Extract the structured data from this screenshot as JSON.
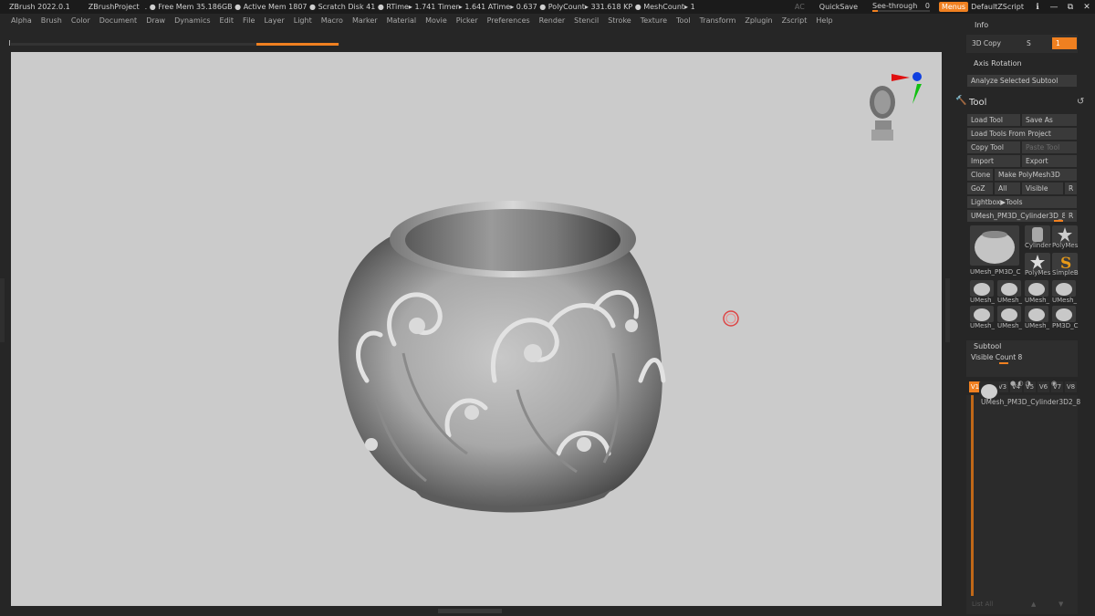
{
  "titlebar": {
    "app": "ZBrush 2022.0.1",
    "project": "ZBrushProject",
    "stats": ". ● Free Mem 35.186GB ● Active Mem 1807 ● Scratch Disk 41 ●  RTime▸ 1.741 Timer▸ 1.641 ATime▸ 0.637 ● PolyCount▸ 331.618 KP  ● MeshCount▸ 1",
    "ac": "AC",
    "quicksave": "QuickSave",
    "seethrough": "See-through",
    "seethrough_value": "0",
    "menus": "Menus",
    "script": "DefaultZScript",
    "win_icons": [
      "ℹ",
      "—",
      "⧉",
      "✕"
    ]
  },
  "menubar": {
    "items": [
      "Alpha",
      "Brush",
      "Color",
      "Document",
      "Draw",
      "Dynamics",
      "Edit",
      "File",
      "Layer",
      "Light",
      "Macro",
      "Marker",
      "Material",
      "Movie",
      "Picker",
      "Preferences",
      "Render",
      "Stencil",
      "Stroke",
      "Texture",
      "Tool",
      "Transform",
      "Zplugin",
      "Zscript",
      "Help"
    ]
  },
  "right": {
    "info": "Info",
    "copy3d": "3D Copy",
    "copy3d_s": "S",
    "copy3d_val": "1",
    "axis_rotation": "Axis Rotation",
    "analyze": "Analyze Selected Subtool",
    "tool": "Tool",
    "load_tool": "Load Tool",
    "save_as": "Save As",
    "load_from_project": "Load Tools From Project",
    "copy_tool": "Copy Tool",
    "paste_tool": "Paste Tool",
    "import": "Import",
    "export": "Export",
    "clone": "Clone",
    "make_polymesh": "Make PolyMesh3D",
    "goz": "GoZ",
    "all": "All",
    "visible": "Visible",
    "r": "R",
    "lightbox_tools": "Lightbox▶Tools",
    "current_tool": "UMesh_PM3D_Cylinder3D_8",
    "current_tool_r": "R",
    "thumb_labels": [
      "UMesh_PM3D_C",
      "Cylinder",
      "PolyMes",
      "PolyMes",
      "SimpleB",
      "UMesh_",
      "UMesh_",
      "UMesh_",
      "UMesh_",
      "UMesh_",
      "UMesh_",
      "UMesh_",
      "PM3D_C"
    ],
    "subtool": "Subtool",
    "visible_count": "Visible Count 8",
    "vtabs": [
      "V1",
      "V2",
      "V3",
      "V4",
      "V5",
      "V6",
      "V7",
      "V8"
    ],
    "subtool_name": "UMesh_PM3D_Cylinder3D2_8",
    "list_all": "List All"
  }
}
